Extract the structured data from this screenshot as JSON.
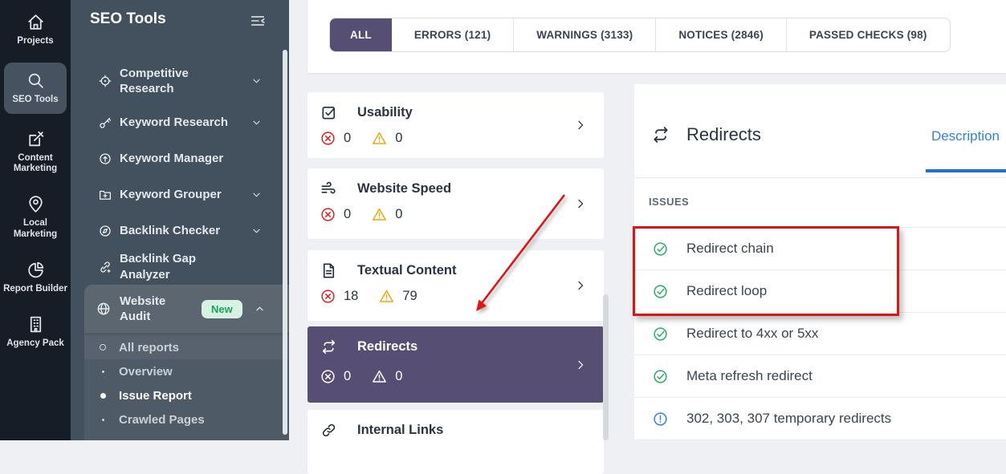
{
  "colors": {
    "accent_purple": "#574e73",
    "error_red": "#e02020",
    "warning_amber": "#f0a60c",
    "success_green": "#27ae60",
    "info_blue": "#2f80ed",
    "annotation_red": "#dd1414"
  },
  "rail": {
    "items": [
      {
        "id": "projects",
        "label": "Projects",
        "icon": "home",
        "active": false
      },
      {
        "id": "seo-tools",
        "label": "SEO Tools",
        "icon": "search",
        "active": true
      },
      {
        "id": "content-marketing",
        "label": "Content Marketing",
        "icon": "compose",
        "active": false
      },
      {
        "id": "local-marketing",
        "label": "Local Marketing",
        "icon": "pin",
        "active": false
      },
      {
        "id": "report-builder",
        "label": "Report Builder",
        "icon": "pie",
        "active": false
      },
      {
        "id": "agency-pack",
        "label": "Agency Pack",
        "icon": "building",
        "active": false
      }
    ]
  },
  "sidebar": {
    "title": "SEO Tools",
    "items": [
      {
        "id": "competitive-research",
        "label": "Competitive Research",
        "icon": "target",
        "chevron": "down",
        "twolines": true
      },
      {
        "id": "keyword-research",
        "label": "Keyword Research",
        "icon": "key",
        "chevron": "down",
        "twolines": false
      },
      {
        "id": "keyword-manager",
        "label": "Keyword Manager",
        "icon": "circle-up",
        "chevron": null,
        "twolines": false
      },
      {
        "id": "keyword-grouper",
        "label": "Keyword Grouper",
        "icon": "folder-plus",
        "chevron": "down",
        "twolines": false
      },
      {
        "id": "backlink-checker",
        "label": "Backlink Checker",
        "icon": "compass",
        "chevron": "down",
        "twolines": false
      },
      {
        "id": "backlink-gap-analyzer",
        "label": "Backlink Gap Analyzer",
        "icon": "link-plus",
        "chevron": null,
        "twolines": false
      }
    ],
    "audit": {
      "label": "Website Audit",
      "icon": "globe",
      "badge": "New",
      "submenu": [
        {
          "id": "all-reports",
          "label": "All reports",
          "marker": "circle",
          "rowhl": true,
          "current": false
        },
        {
          "id": "overview",
          "label": "Overview",
          "marker": "dot",
          "rowhl": false,
          "current": false
        },
        {
          "id": "issue-report",
          "label": "Issue Report",
          "marker": "bullet",
          "rowhl": false,
          "current": true
        },
        {
          "id": "crawled-pages",
          "label": "Crawled Pages",
          "marker": "dot",
          "rowhl": false,
          "current": false
        }
      ]
    }
  },
  "tabs": [
    {
      "id": "all",
      "label": "ALL",
      "active": true
    },
    {
      "id": "errors",
      "label": "ERRORS (121)",
      "active": false
    },
    {
      "id": "warnings",
      "label": "WARNINGS (3133)",
      "active": false
    },
    {
      "id": "notices",
      "label": "NOTICES (2846)",
      "active": false
    },
    {
      "id": "passed-checks",
      "label": "PASSED CHECKS (98)",
      "active": false
    }
  ],
  "categories": [
    {
      "id": "usability",
      "label": "Usability",
      "icon": "checkbox",
      "errors": "0",
      "warnings": "0",
      "selected": false,
      "partial": false
    },
    {
      "id": "website-speed",
      "label": "Website Speed",
      "icon": "wind",
      "errors": "0",
      "warnings": "0",
      "selected": false,
      "partial": false
    },
    {
      "id": "textual-content",
      "label": "Textual Content",
      "icon": "document",
      "errors": "18",
      "warnings": "79",
      "selected": false,
      "partial": false
    },
    {
      "id": "redirects",
      "label": "Redirects",
      "icon": "loop",
      "errors": "0",
      "warnings": "0",
      "selected": true,
      "partial": false
    },
    {
      "id": "internal-links",
      "label": "Internal Links",
      "icon": "chain",
      "errors": "",
      "warnings": "",
      "selected": false,
      "partial": true
    }
  ],
  "panel": {
    "title": "Redirects",
    "icon": "loop",
    "tab_label": "Description",
    "section_label": "ISSUES",
    "issues": [
      {
        "label": "Redirect chain",
        "status": "passed"
      },
      {
        "label": "Redirect loop",
        "status": "passed"
      },
      {
        "label": "Redirect to 4xx or 5xx",
        "status": "passed"
      },
      {
        "label": "Meta refresh redirect",
        "status": "passed"
      },
      {
        "label": "302, 303, 307 temporary redirects",
        "status": "notice"
      }
    ]
  }
}
